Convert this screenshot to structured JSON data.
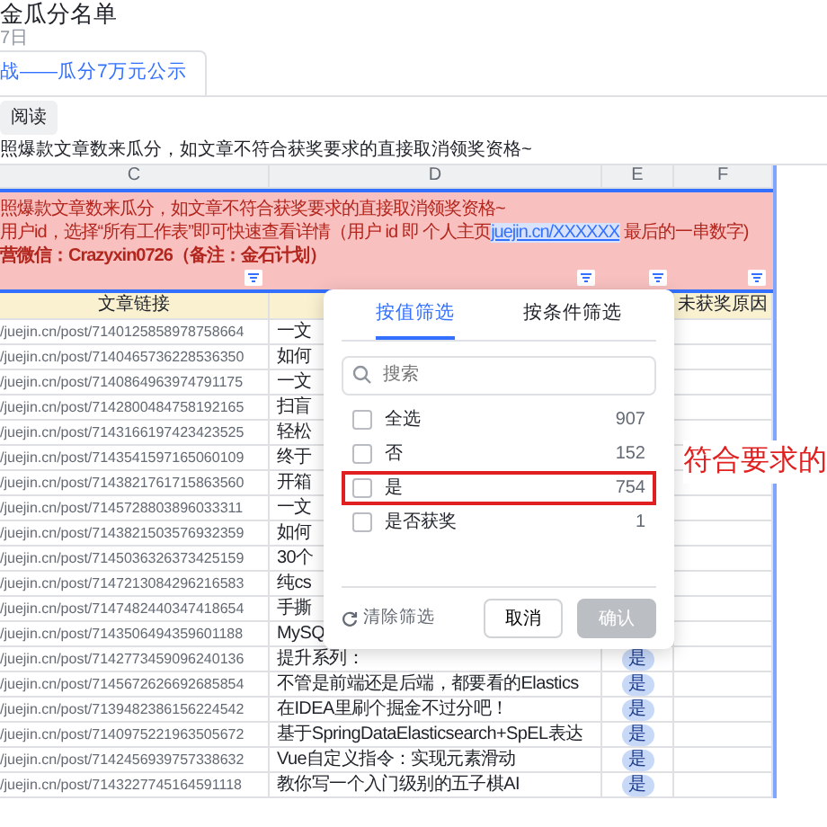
{
  "document": {
    "title": "金瓜分名单",
    "date": "7日"
  },
  "sheet_tabs": [
    {
      "label": "战——瓜分7万元公示",
      "selected": true
    }
  ],
  "toolbar": {
    "button": "阅读"
  },
  "formula_bar": {
    "text": "照爆款文章数来瓜分，如文章不符合获奖要求的直接取消领奖资格~"
  },
  "columns": [
    "C",
    "D",
    "E",
    "F"
  ],
  "notice": {
    "line_1": "照爆款文章数来瓜分，如文章不符合获奖要求的直接取消领奖资格~",
    "line_2": {
      "before": "用户id，选择“所有工作表”即可快速查看详情（用户 id 即 个人主页",
      "link": "juejin.cn/XXXXXX",
      "after": " 最后的一串数字)"
    },
    "line_3": "营微信：Crazyxin0726（备注：金石计划）"
  },
  "header_row": {
    "column_c": "文章链接",
    "column_f": "未获奖原因"
  },
  "rows": [
    {
      "link": "/juejin.cn/post/7140125858978758664",
      "title": "一文"
    },
    {
      "link": "/juejin.cn/post/7140465736228536350",
      "title": "如何"
    },
    {
      "link": "/juejin.cn/post/7140864963974791175",
      "title": "一文"
    },
    {
      "link": "/juejin.cn/post/7142800484758192165",
      "title": "扫盲"
    },
    {
      "link": "/juejin.cn/post/7143166197423423525",
      "title": "轻松"
    },
    {
      "link": "/juejin.cn/post/7143541597165060109",
      "title": "终于"
    },
    {
      "link": "/juejin.cn/post/7143821761715863560",
      "title": "开箱"
    },
    {
      "link": "/juejin.cn/post/7145728803896033311",
      "title": "一文"
    },
    {
      "link": "/juejin.cn/post/7143821503576932359",
      "title": "如何"
    },
    {
      "link": "/juejin.cn/post/7145036326373425159",
      "title": "30个"
    },
    {
      "link": "/juejin.cn/post/7147213084296216583",
      "title": "纯cs"
    },
    {
      "link": "/juejin.cn/post/7147482440347418654",
      "title": "手撕"
    },
    {
      "link": "/juejin.cn/post/7143506494359601188",
      "title": "MySQ"
    },
    {
      "link": "/juejin.cn/post/7142773459096240136",
      "title": "提升系列：",
      "award": "是"
    },
    {
      "link": "/juejin.cn/post/7145672626692685854",
      "title": "不管是前端还是后端，都要看的Elastics",
      "award": "是"
    },
    {
      "link": "/juejin.cn/post/7139482386156224542",
      "title": "在IDEA里刷个掘金不过分吧！",
      "award": "是"
    },
    {
      "link": "/juejin.cn/post/7140975221963505672",
      "title": "基于SpringDataElasticsearch+SpEL表达",
      "award": "是"
    },
    {
      "link": "/juejin.cn/post/7142456939757338632",
      "title": "Vue自定义指令：实现元素滑动",
      "award": "是"
    },
    {
      "link": "/juejin.cn/post/7143227745164591118",
      "title": "教你写一个入门级别的五子棋AI",
      "award": "是"
    }
  ],
  "filter_popup": {
    "tabs": [
      {
        "label": "按值筛选",
        "selected": true
      },
      {
        "label": "按条件筛选",
        "selected": false
      }
    ],
    "search": {
      "placeholder": "搜索"
    },
    "options": [
      {
        "label": "全选",
        "count": "907",
        "checked": false,
        "highlighted": false
      },
      {
        "label": "否",
        "count": "152",
        "checked": false,
        "highlighted": false
      },
      {
        "label": "是",
        "count": "754",
        "checked": false,
        "highlighted": true
      },
      {
        "label": "是否获奖",
        "count": "1",
        "checked": false,
        "highlighted": false
      }
    ],
    "clear": "清除筛选",
    "buttons": [
      {
        "label": "取消",
        "disabled": false
      },
      {
        "label": "确认",
        "disabled": true
      }
    ]
  },
  "annotation": "符合要求的"
}
